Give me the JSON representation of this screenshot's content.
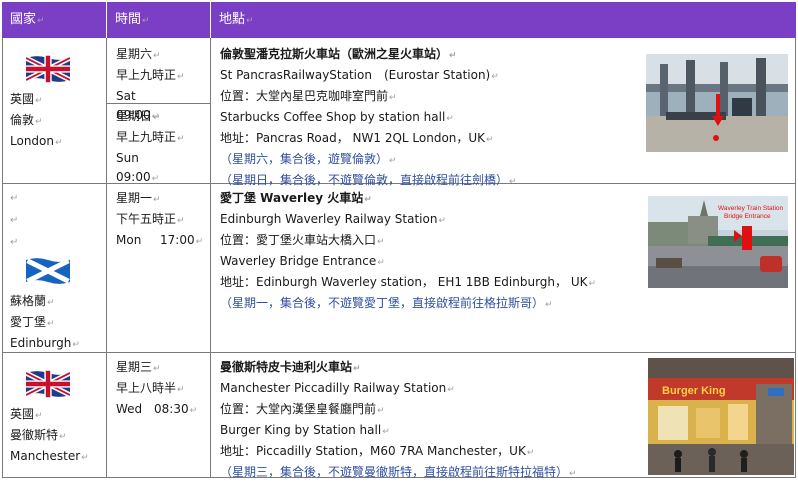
{
  "header": {
    "country": "國家",
    "time": "時間",
    "place": "地點"
  },
  "rows": [
    {
      "country_lines": [
        "英國",
        "倫敦",
        "London"
      ],
      "flag": "union-jack",
      "times": [
        {
          "cn_day": "星期六",
          "cn_time": "早上九時正",
          "en_day": "Sat",
          "en_time": "09:00"
        },
        {
          "cn_day": "星期日",
          "cn_time": "早上九時正",
          "en_day": "Sun",
          "en_time": "09:00"
        }
      ],
      "station_title": "倫敦聖潘克拉斯火車站（歐洲之星火車站）",
      "station_en": "St PancrasRailwayStation　(Eurostar Station)",
      "position_cn": "位置：大堂內星巴克咖啡室門前",
      "position_en": "Starbucks Coffee Shop by station hall",
      "address": "地址：Pancras Road， NW1 2QL London，UK",
      "notes": [
        "（星期六，集合後，遊覽倫敦）",
        "（星期日，集合後，不遊覽倫敦，直接啟程前往劍橋）"
      ]
    },
    {
      "country_lines": [
        "蘇格蘭",
        "愛丁堡",
        "Edinburgh"
      ],
      "flag": "saltire",
      "times": [
        {
          "cn_day": "星期一",
          "cn_time": "下午五時正",
          "en_day": "Mon",
          "en_time": "17:00"
        }
      ],
      "station_title": "愛丁堡 Waverley 火車站",
      "station_en": "Edinburgh Waverley Railway Station",
      "position_cn": "位置：愛丁堡火車站大橋入口",
      "position_en": "Waverley Bridge Entrance",
      "address": "地址：Edinburgh Waverley station，  EH1 1BB Edinburgh，  UK",
      "notes": [
        "（星期一，集合後，不遊覽愛丁堡，直接啟程前往格拉斯哥）"
      ],
      "photo_caption": [
        "Waverley Train Station",
        "Bridge Entrance"
      ]
    },
    {
      "country_lines": [
        "英國",
        "曼徹斯特",
        "Manchester"
      ],
      "flag": "union-jack",
      "times": [
        {
          "cn_day": "星期三",
          "cn_time": "早上八時半",
          "en_day": "Wed",
          "en_time": "08:30"
        }
      ],
      "station_title": "曼徹斯特皮卡迪利火車站",
      "station_en": "Manchester Piccadilly Railway Station",
      "position_cn": "位置：大堂內漢堡皇餐廳門前",
      "position_en": "Burger King by Station hall",
      "address": "地址：Piccadilly Station，M60 7RA Manchester，UK",
      "notes": [
        "（星期三，集合後，不遊覽曼徹斯特，直接啟程前往斯特拉福特）"
      ],
      "photo_sign": "Burger King"
    }
  ],
  "colors": {
    "header_bg": "#7b3fc6",
    "note_text": "#2f4f9f",
    "grid": "#7a7a7a"
  }
}
